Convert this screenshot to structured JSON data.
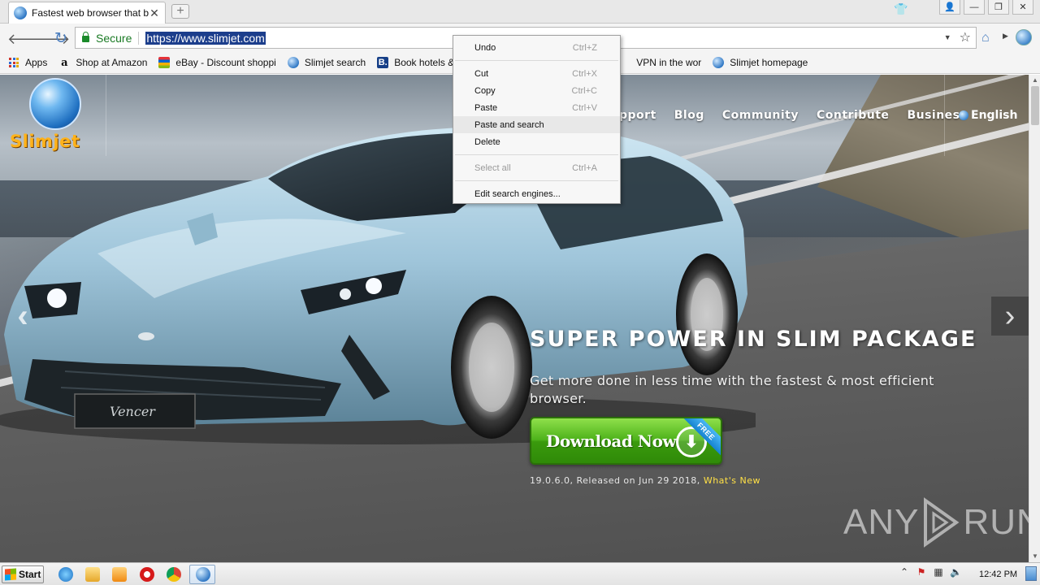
{
  "tab": {
    "title": "Fastest web browser that bl",
    "close": "✕",
    "new_tab": "+"
  },
  "window": {
    "shirt_icon": "👕",
    "user_icon": "👤",
    "minimize": "—",
    "restore": "❐",
    "close": "✕"
  },
  "toolbar": {
    "back": "🡐",
    "forward": "🡒",
    "reload": "↻",
    "secure_label": "Secure",
    "url": "https://www.slimjet.com",
    "dropdown": "▼",
    "star": "☆",
    "home": "⌂",
    "menu_arrow": "▶"
  },
  "bookmarks": [
    {
      "label": "Apps",
      "icon": "apps-grid-icon"
    },
    {
      "label": "Shop at Amazon",
      "icon": "amazon-icon"
    },
    {
      "label": "eBay - Discount shoppi",
      "icon": "ebay-icon"
    },
    {
      "label": "Slimjet search",
      "icon": "globe-icon"
    },
    {
      "label": "Book hotels & vac",
      "icon": "booking-icon"
    },
    {
      "label": "VPN in the wor",
      "icon": "vpn-icon"
    },
    {
      "label": "Slimjet homepage",
      "icon": "globe-icon"
    }
  ],
  "site": {
    "logo_text": "Slimjet",
    "nav": [
      "pport",
      "Blog",
      "Community",
      "Contribute",
      "Business"
    ],
    "language": "English",
    "hero_title": "SUPER POWER IN SLIM PACKAGE",
    "hero_subtitle": "Get more done in less time with the fastest & most efficient browser.",
    "download_label": "Download Now",
    "free_badge": "FREE",
    "version_text": "19.0.6.0, Released on Jun 29 2018,",
    "whats_new": "What's New",
    "plate_text": "Vencer",
    "arrow_left": "‹",
    "arrow_right": "›"
  },
  "context_menu": [
    {
      "label": "Undo",
      "shortcut": "Ctrl+Z",
      "disabled": false
    },
    {
      "sep": true
    },
    {
      "label": "Cut",
      "shortcut": "Ctrl+X",
      "disabled": false
    },
    {
      "label": "Copy",
      "shortcut": "Ctrl+C",
      "disabled": false
    },
    {
      "label": "Paste",
      "shortcut": "Ctrl+V",
      "disabled": false
    },
    {
      "label": "Paste and search",
      "shortcut": "",
      "disabled": false,
      "hover": true
    },
    {
      "label": "Delete",
      "shortcut": "",
      "disabled": false
    },
    {
      "sep": true
    },
    {
      "label": "Select all",
      "shortcut": "Ctrl+A",
      "disabled": true
    },
    {
      "sep": true
    },
    {
      "label": "Edit search engines...",
      "shortcut": "",
      "disabled": false
    }
  ],
  "watermark": {
    "left": "ANY",
    "right": "RUN"
  },
  "taskbar": {
    "start_label": "Start",
    "clock": "12:42 PM",
    "tray_up": "⌃"
  },
  "colors": {
    "secure_green": "#1a7a24",
    "url_highlight": "#1c3e8c",
    "logo_orange": "#ffb21a",
    "download_green": "#4db21a",
    "whats_new_yellow": "#ffe046"
  }
}
